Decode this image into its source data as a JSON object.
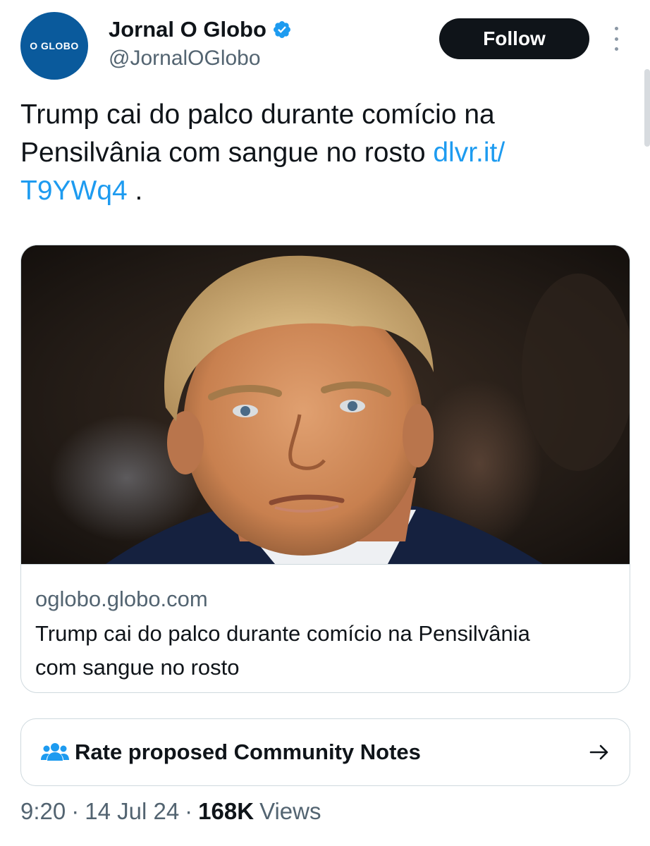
{
  "author": {
    "avatar_text": "O GLOBO",
    "display_name": "Jornal O Globo",
    "handle": "@JornalOGlobo",
    "verified": true,
    "follow_label": "Follow"
  },
  "tweet": {
    "text": "Trump cai do palco durante comício na Pensilvânia com sangue no rosto ",
    "link_text": "dlvr.it/ T9YWq4",
    "trailing": " ."
  },
  "card": {
    "domain": "oglobo.globo.com",
    "title": "Trump cai do palco durante comício na Pensilvânia com sangue no rosto"
  },
  "community_notes": {
    "label": "Rate proposed Community Notes"
  },
  "meta": {
    "time": "9:20",
    "date": "14 Jul 24",
    "views_count": "168K",
    "views_label": "Views"
  },
  "colors": {
    "accent": "#1d9bf0",
    "text": "#0f1419",
    "muted": "#536471",
    "brand": "#0a5a9c"
  }
}
